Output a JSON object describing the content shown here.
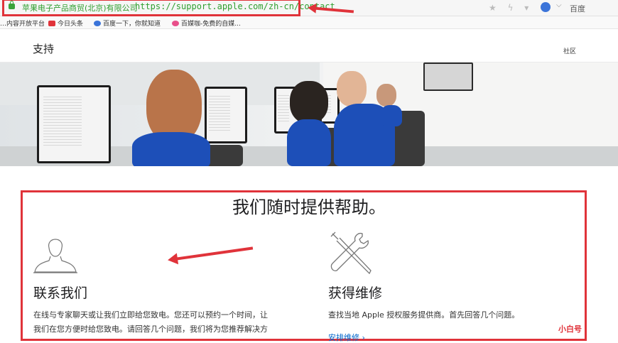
{
  "browser": {
    "site_name": "苹果电子产品商贸(北京)有限公司",
    "url": "https://support.apple.com/zh-cn/contact",
    "search_engine_label": "百度",
    "toolbar_icons": [
      "star-icon",
      "lightning-icon",
      "chevron-down-icon"
    ]
  },
  "bookmarks": [
    {
      "label": "…内容开放平台",
      "icon": "page-icon",
      "color": "#9aa"
    },
    {
      "label": "今日头条",
      "icon": "toutiao-icon",
      "color": "#e0333a"
    },
    {
      "label": "百度一下，你就知道",
      "icon": "baidu-paw-icon",
      "color": "#3b74d9"
    },
    {
      "label": "百媒咖-免费的自媒...",
      "icon": "media-icon",
      "color": "#e84f8a"
    }
  ],
  "nav": {
    "title": "支持",
    "community": "社区"
  },
  "section": {
    "heading": "我们随时提供帮助。"
  },
  "contact": {
    "title": "联系我们",
    "text_line1": "在线与专家聊天或让我们立即给您致电。您还可以预约一个时间，让",
    "text_line2": "我们在您方便时给您致电。请回答几个问题，我们将为您推荐解决方"
  },
  "repair": {
    "title": "获得维修",
    "text": "查找当地 Apple 授权服务提供商。首先回答几个问题。",
    "link": "安排维修 ›"
  },
  "watermark": {
    "text": "小白号"
  },
  "colors": {
    "annotation_red": "#e0333a",
    "link_blue": "#0066cc",
    "secure_green": "#2f9f2f"
  }
}
